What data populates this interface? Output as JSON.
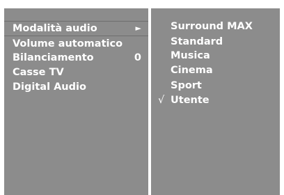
{
  "menu": {
    "items": [
      {
        "label": "Modalità audio",
        "arrow": "►",
        "value": ""
      },
      {
        "label": "Volume automatico",
        "arrow": "",
        "value": ""
      },
      {
        "label": "Bilanciamento",
        "arrow": "",
        "value": "0"
      },
      {
        "label": "Casse TV",
        "arrow": "",
        "value": ""
      },
      {
        "label": "Digital Audio",
        "arrow": "",
        "value": ""
      }
    ]
  },
  "submenu": {
    "options": [
      {
        "label": "Surround MAX",
        "check": ""
      },
      {
        "label": "Standard",
        "check": ""
      },
      {
        "label": "Musica",
        "check": ""
      },
      {
        "label": "Cinema",
        "check": ""
      },
      {
        "label": "Sport",
        "check": ""
      },
      {
        "label": "Utente",
        "check": "√"
      }
    ]
  },
  "colors": {
    "panel": "#8c8c8c",
    "text": "#ffffff",
    "background": "#ffffff"
  }
}
